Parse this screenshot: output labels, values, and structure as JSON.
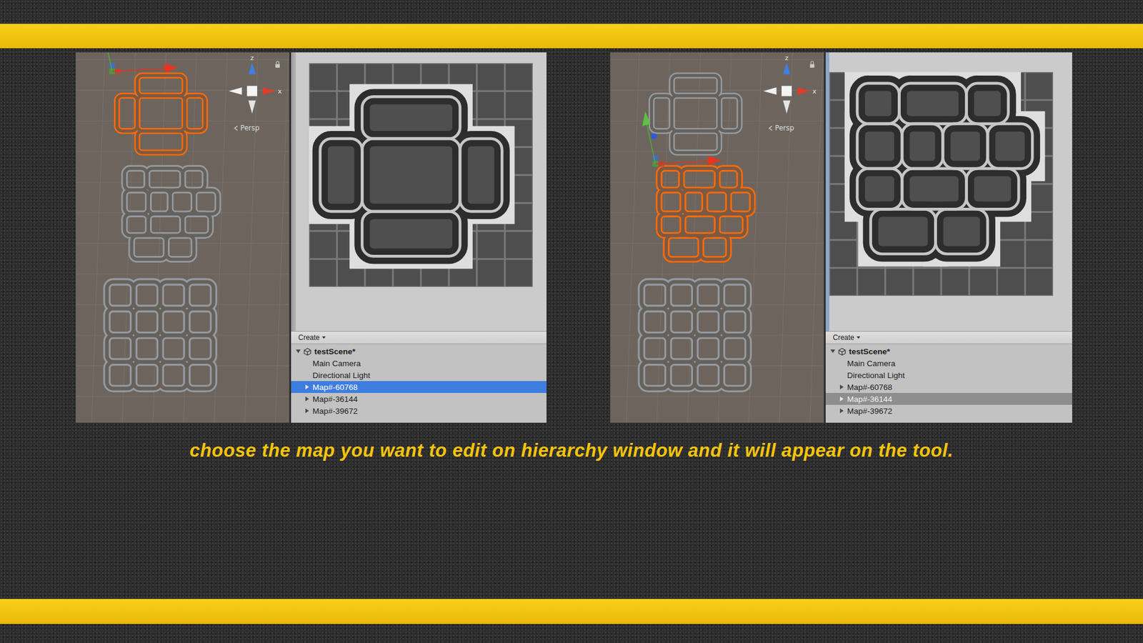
{
  "panels": [
    {
      "scene_view": {
        "axis_labels": [
          "z",
          "x"
        ],
        "projection": "Persp"
      },
      "hierarchy": {
        "create_label": "Create",
        "scene_name": "testScene*",
        "scene_expanded": true,
        "focused": true,
        "items": [
          {
            "label": "Main Camera",
            "kind": "object",
            "selected": false
          },
          {
            "label": "Directional Light",
            "kind": "object",
            "selected": false
          },
          {
            "label": "Map#-60768",
            "kind": "map",
            "expanded": false,
            "selected": true
          },
          {
            "label": "Map#-36144",
            "kind": "map",
            "expanded": false,
            "selected": false
          },
          {
            "label": "Map#-39672",
            "kind": "map",
            "expanded": false,
            "selected": false
          }
        ]
      }
    },
    {
      "scene_view": {
        "axis_labels": [
          "z",
          "x"
        ],
        "projection": "Persp"
      },
      "hierarchy": {
        "create_label": "Create",
        "scene_name": "testScene*",
        "scene_expanded": true,
        "focused": false,
        "items": [
          {
            "label": "Main Camera",
            "kind": "object",
            "selected": false
          },
          {
            "label": "Directional Light",
            "kind": "object",
            "selected": false
          },
          {
            "label": "Map#-60768",
            "kind": "map",
            "expanded": false,
            "selected": false
          },
          {
            "label": "Map#-36144",
            "kind": "map",
            "expanded": false,
            "selected": true
          },
          {
            "label": "Map#-39672",
            "kind": "map",
            "expanded": false,
            "selected": false
          }
        ]
      }
    }
  ],
  "caption": "choose the map you want to edit on hierarchy window and it will appear on the tool."
}
